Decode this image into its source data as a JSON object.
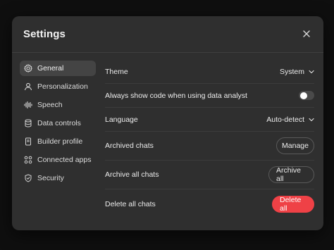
{
  "dialog": {
    "title": "Settings",
    "close_icon": "close-icon"
  },
  "sidebar": {
    "items": [
      {
        "label": "General",
        "icon": "gear-icon",
        "active": true
      },
      {
        "label": "Personalization",
        "icon": "person-icon",
        "active": false
      },
      {
        "label": "Speech",
        "icon": "waveform-icon",
        "active": false
      },
      {
        "label": "Data controls",
        "icon": "database-icon",
        "active": false
      },
      {
        "label": "Builder profile",
        "icon": "id-card-icon",
        "active": false
      },
      {
        "label": "Connected apps",
        "icon": "apps-grid-icon",
        "active": false
      },
      {
        "label": "Security",
        "icon": "shield-icon",
        "active": false
      }
    ]
  },
  "settings": {
    "theme": {
      "label": "Theme",
      "value": "System"
    },
    "code": {
      "label": "Always show code when using data analyst",
      "enabled": false
    },
    "language": {
      "label": "Language",
      "value": "Auto-detect"
    },
    "archived": {
      "label": "Archived chats",
      "button": "Manage"
    },
    "archive_all": {
      "label": "Archive all chats",
      "button": "Archive all"
    },
    "delete_all": {
      "label": "Delete all chats",
      "button": "Delete all"
    }
  },
  "colors": {
    "danger": "#ef4146",
    "dialog_bg": "#2f2f2f",
    "active_nav_bg": "#444444"
  }
}
